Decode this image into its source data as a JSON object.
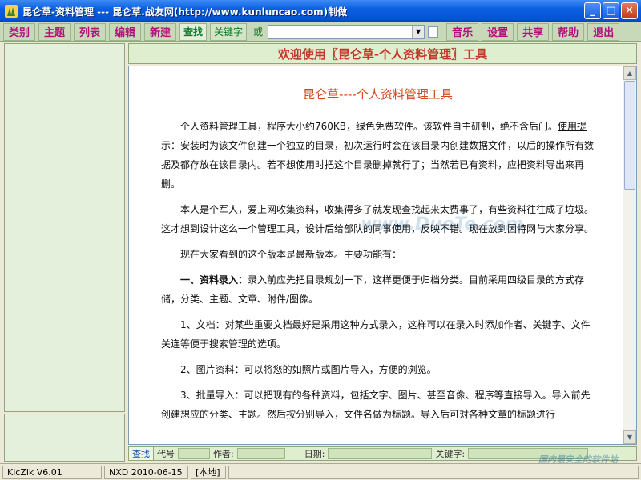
{
  "window": {
    "title": "昆仑草-资料管理 --- 昆仑草.战友网(http://www.kunluncao.com)制做",
    "minimize": "_",
    "maximize": "□",
    "close": "✕",
    "icon": "app-grass-icon"
  },
  "toolbar": {
    "left_buttons": [
      "类别",
      "主题",
      "列表",
      "编辑",
      "新建"
    ],
    "find_label": "查找",
    "keyword_label": "关键字",
    "or_label": "或",
    "search_value": "",
    "right_buttons": [
      "音乐",
      "设置",
      "共享",
      "帮助",
      "退出"
    ]
  },
  "header": {
    "welcome": "欢迎使用〖昆仑草-个人资料管理〗工具"
  },
  "document": {
    "title": "昆仑草----个人资料管理工具",
    "p1_a": "个人资料管理工具，程序大小约760KB，绿色免费软件。该软件自主研制，绝不含后门。",
    "p1_ul": "使用提示：",
    "p1_b": "安装时为该文件创建一个独立的目录，初次运行时会在该目录内创建数据文件，以后的操作所有数据及都存放在该目录内。若不想使用时把这个目录删掉就行了；当然若已有资料，应把资料导出来再删。",
    "p2": "本人是个军人，爱上网收集资料，收集得多了就发现查找起来太费事了，有些资料往往成了垃圾。这才想到设计这么一个管理工具，设计后给部队的同事使用，反映不错。现在放到因特网与大家分享。",
    "p3": "现在大家看到的这个版本是最新版本。主要功能有：",
    "p4_b": "一、资料录入：",
    "p4": "录入前应先把目录规划一下，这样更便于归档分类。目前采用四级目录的方式存储，分类、主题、文章、附件/图像。",
    "p5": "1、文档：对某些重要文档最好是采用这种方式录入，这样可以在录入时添加作者、关键字、文件关连等便于搜索管理的选项。",
    "p6": "2、图片资料：可以将您的如照片或图片导入，方便的浏览。",
    "p7": "3、批量导入：可以把现有的各种资料，包括文字、图片、甚至音像、程序等直接导入。导入前先创建想应的分类、主题。然后按分别导入，文件名做为标题。导入后可对各种文章的标题进行"
  },
  "searchbar": {
    "find": "查找",
    "code": "代号",
    "author": "作者:",
    "date": "日期:",
    "keyword": "关键字:"
  },
  "status": {
    "version": "KlcZlk V6.01",
    "build": "NXD 2010-06-15",
    "mode": "[本地]"
  },
  "watermark": {
    "duote": "www.DuoTe.com",
    "brand": "国内最安全的软件站"
  }
}
